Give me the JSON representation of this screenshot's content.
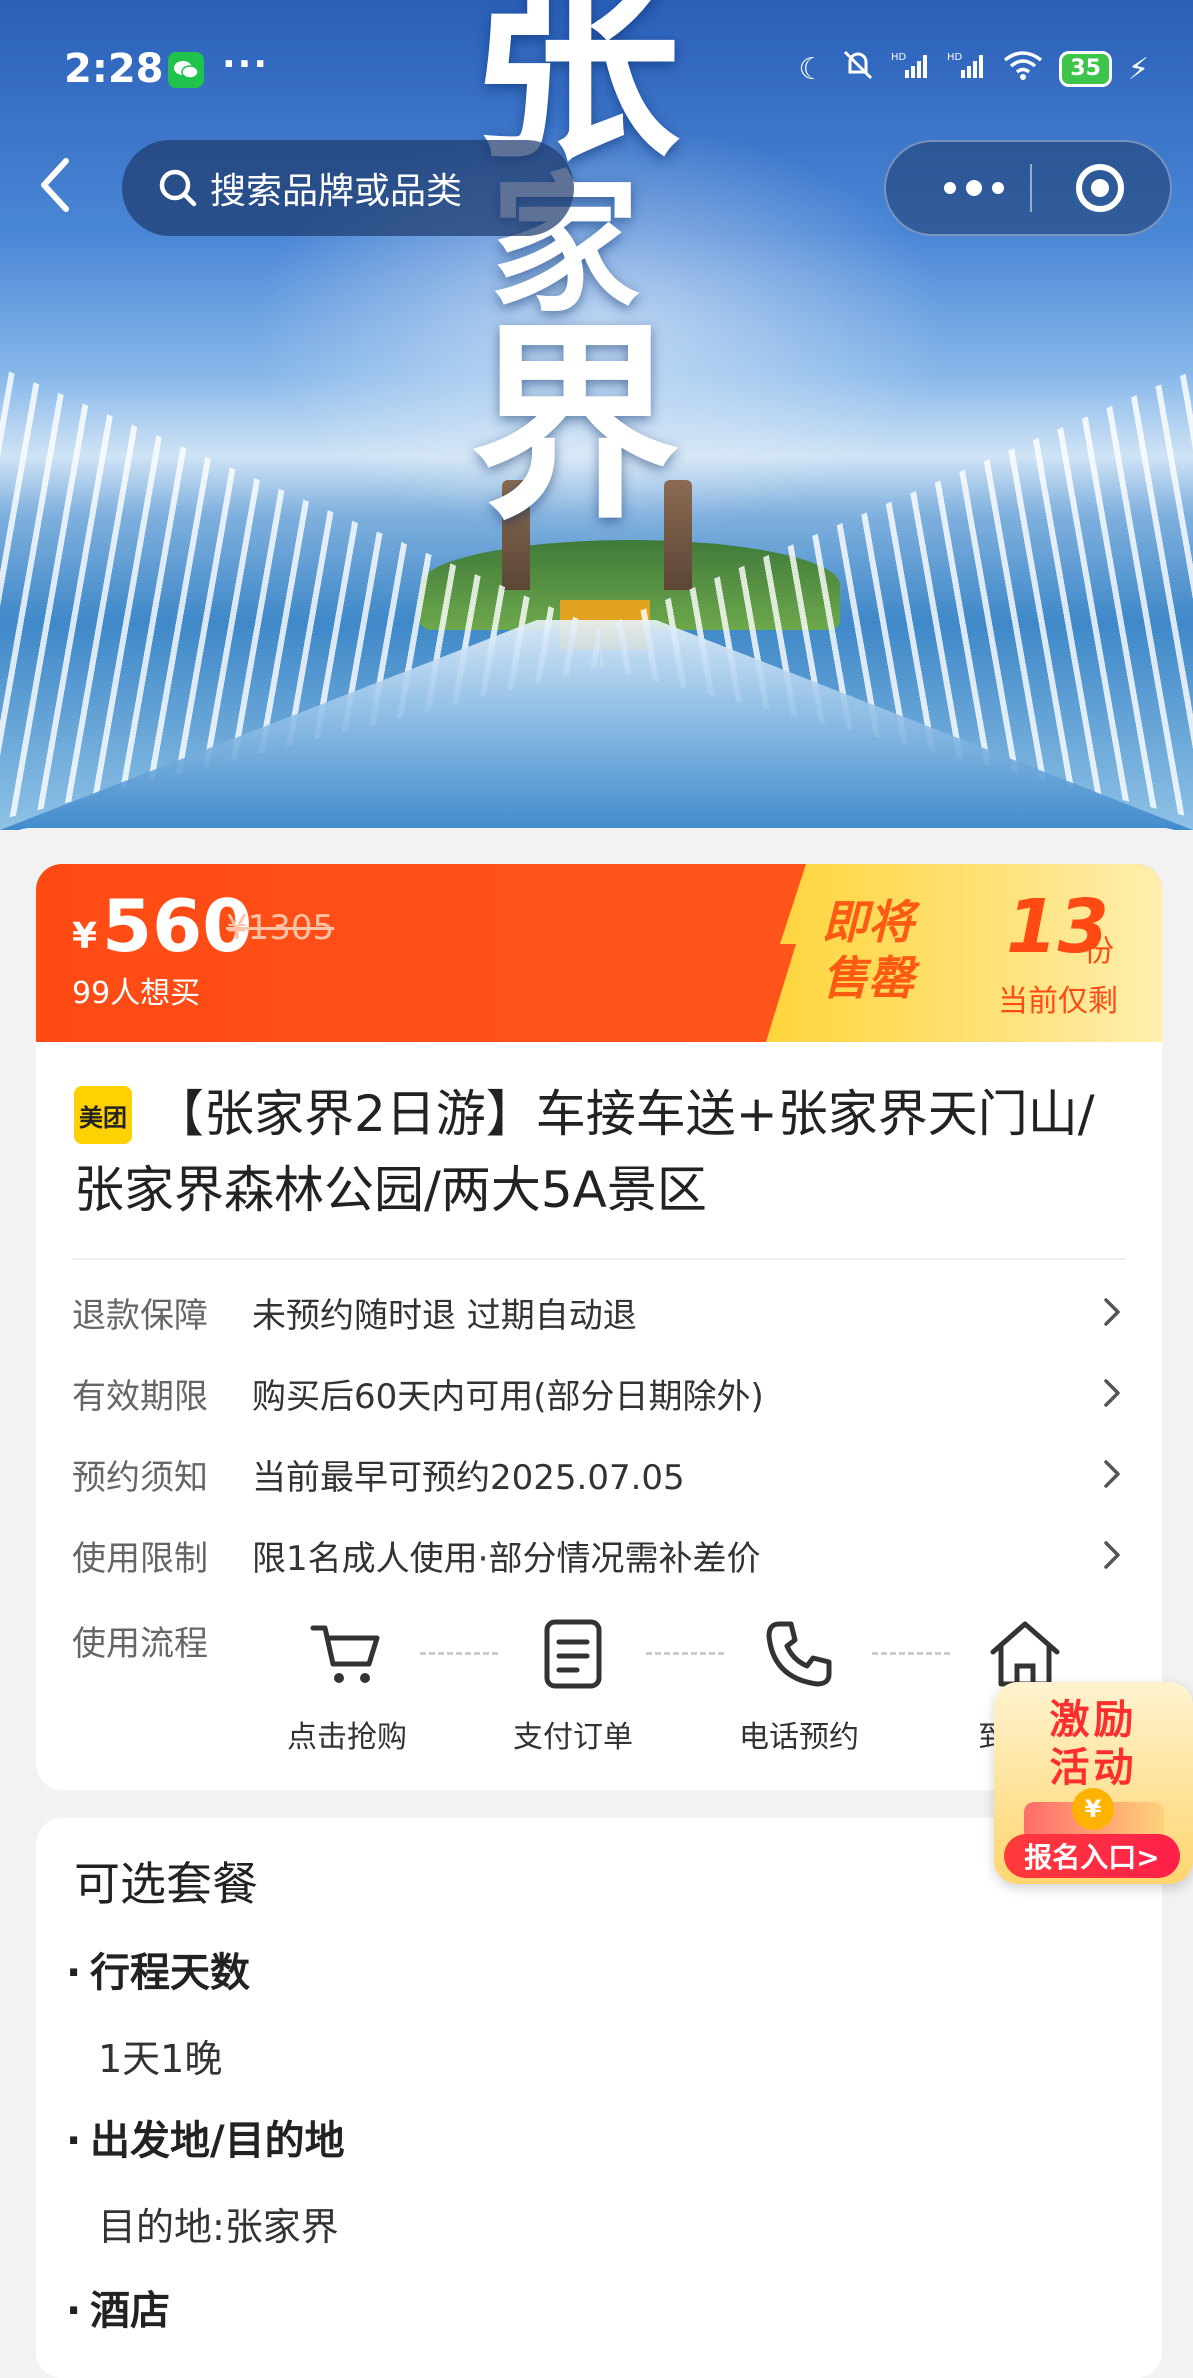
{
  "status_bar": {
    "time": "2:28",
    "more": "···",
    "battery": "35"
  },
  "nav": {
    "search_placeholder": "搜索品牌或品类"
  },
  "hero": {
    "calligraphy": [
      "张",
      "家",
      "界"
    ]
  },
  "price_bar": {
    "currency": "¥",
    "price": "560",
    "original_price": "¥1305",
    "want_count": "99人想买",
    "selling_out": [
      "即将",
      "售罄"
    ],
    "remaining_count": "13",
    "remaining_unit": "份",
    "remaining_label": "当前仅剩"
  },
  "product": {
    "badge": "美团",
    "title": "【张家界2日游】车接车送+张家界天门山/张家界森林公园/两大5A景区"
  },
  "info_rows": [
    {
      "key": "退款保障",
      "value": "未预约随时退 过期自动退"
    },
    {
      "key": "有效期限",
      "value": "购买后60天内可用(部分日期除外)"
    },
    {
      "key": "预约须知",
      "value": "当前最早可预约2025.07.05"
    },
    {
      "key": "使用限制",
      "value": "限1名成人使用·部分情况需补差价"
    }
  ],
  "flow": {
    "label": "使用流程",
    "steps": [
      {
        "label": "点击抢购",
        "icon": "cart-icon"
      },
      {
        "label": "支付订单",
        "icon": "document-icon"
      },
      {
        "label": "电话预约",
        "icon": "phone-icon"
      },
      {
        "label": "到",
        "icon": "home-icon"
      }
    ]
  },
  "promo": {
    "title": "激励活动",
    "button": "报名入口>"
  },
  "packages": {
    "title": "可选套餐",
    "options": [
      {
        "heading": "行程天数",
        "value": "1天1晚"
      },
      {
        "heading": "出发地/目的地",
        "value": "目的地:张家界"
      },
      {
        "heading": "酒店",
        "value": ""
      }
    ]
  }
}
